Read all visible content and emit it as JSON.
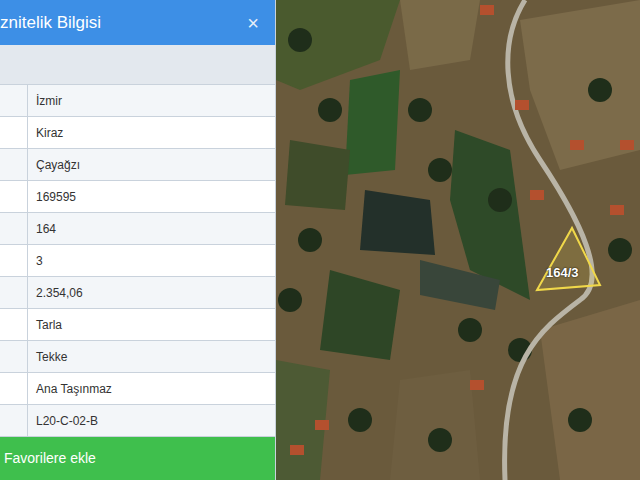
{
  "panel": {
    "title": "znitelik Bilgisi",
    "close": "×",
    "rows": [
      "İzmir",
      "Kiraz",
      "Çayağzı",
      "169595",
      "164",
      "3",
      "2.354,06",
      "Tarla",
      "Tekke",
      "Ana Taşınmaz",
      "L20-C-02-B"
    ],
    "button": "Favorilere ekle"
  },
  "map": {
    "parcel_label": "164/3"
  }
}
